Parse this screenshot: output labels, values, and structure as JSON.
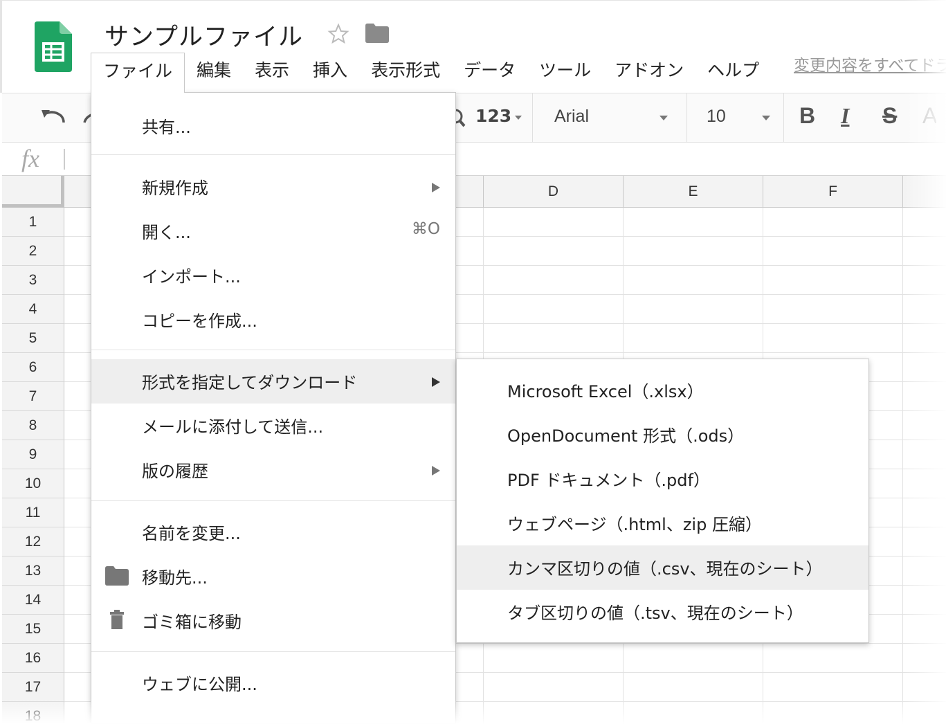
{
  "document": {
    "title": "サンプルファイル",
    "save_status": "変更内容をすべてドライブに保存しました"
  },
  "icons": {
    "logo": "google-sheets-logo",
    "star": "star-outline-icon",
    "folder": "folder-icon",
    "undo": "undo-icon",
    "trash": "trash-icon",
    "fx": "function-icon"
  },
  "colors": {
    "sheets_green": "#1fa463",
    "menu_highlight": "#eeeeee",
    "header_bg": "#f3f3f3"
  },
  "menubar": {
    "items": [
      "ファイル",
      "編集",
      "表示",
      "挿入",
      "表示形式",
      "データ",
      "ツール",
      "アドオン",
      "ヘルプ"
    ],
    "active": "ファイル"
  },
  "toolbar": {
    "number_format": "123",
    "font": "Arial",
    "font_size": "10",
    "bold": "B",
    "italic": "I",
    "strike": "S",
    "text_color": "A"
  },
  "formula_bar": {
    "fx": "fx"
  },
  "grid": {
    "columns": [
      "D",
      "E",
      "F"
    ],
    "rows": [
      "1",
      "2",
      "3",
      "4",
      "5",
      "6",
      "7",
      "8",
      "9",
      "10",
      "11",
      "12",
      "13",
      "14",
      "15",
      "16",
      "17",
      "18"
    ]
  },
  "file_menu": {
    "share": "共有...",
    "new": "新規作成",
    "open": "開く...",
    "open_shortcut": "⌘O",
    "import": "インポート...",
    "make_copy": "コピーを作成...",
    "download_as": "形式を指定してダウンロード",
    "email_attachment": "メールに添付して送信...",
    "version_history": "版の履歴",
    "rename": "名前を変更...",
    "move_to": "移動先...",
    "move_to_trash": "ゴミ箱に移動",
    "publish_to_web": "ウェブに公開..."
  },
  "download_submenu": {
    "items": [
      "Microsoft Excel（.xlsx）",
      "OpenDocument 形式（.ods）",
      "PDF ドキュメント（.pdf）",
      "ウェブページ（.html、zip 圧縮）",
      "カンマ区切りの値（.csv、現在のシート）",
      "タブ区切りの値（.tsv、現在のシート）"
    ],
    "highlighted_index": 4
  }
}
